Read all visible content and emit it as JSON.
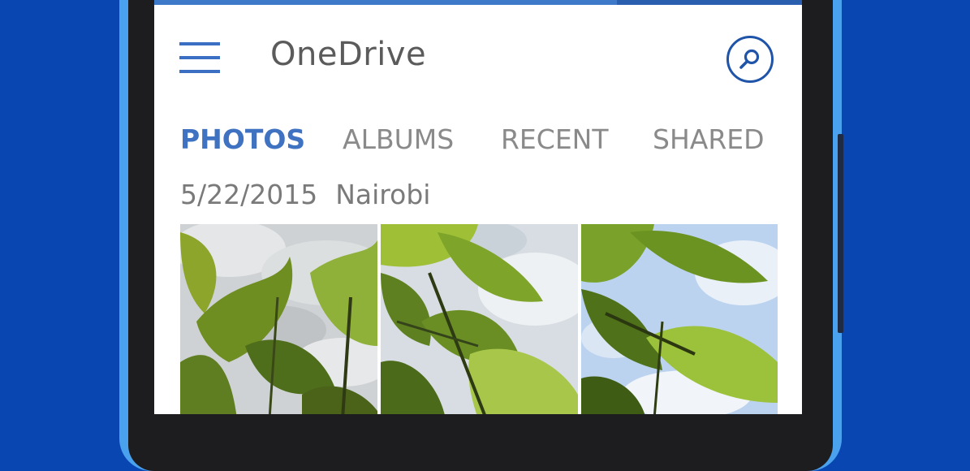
{
  "app": {
    "title": "OneDrive"
  },
  "topbar": {
    "menu_icon": "hamburger-menu-icon",
    "search_icon": "search-icon"
  },
  "tabs": [
    {
      "label": "PHOTOS",
      "active": true
    },
    {
      "label": "ALBUMS",
      "active": false
    },
    {
      "label": "RECENT",
      "active": false
    },
    {
      "label": "SHARED",
      "active": false
    }
  ],
  "group": {
    "date": "5/22/2015",
    "location": "Nairobi"
  },
  "photos": [
    {
      "subject": "leaves against cloudy sky (grayscale sky)"
    },
    {
      "subject": "leaves against cloudy sky"
    },
    {
      "subject": "leaves against blue cloudy sky"
    }
  ],
  "colors": {
    "accent": "#3f72c0",
    "background": "#0a46b2",
    "phone_frame": "#4aa2ee"
  }
}
